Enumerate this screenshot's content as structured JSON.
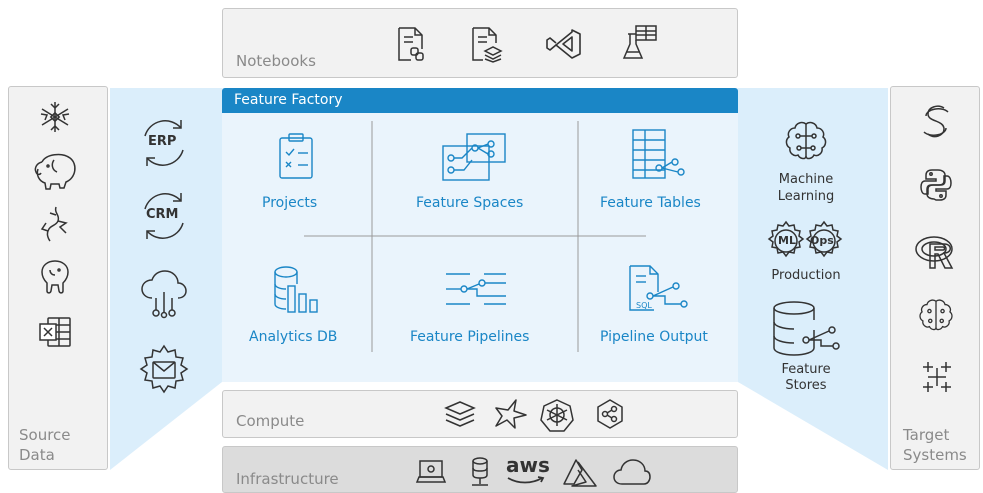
{
  "notebooks": {
    "label": "Notebooks"
  },
  "feature_factory": {
    "title": "Feature Factory",
    "cells": [
      {
        "label": "Projects"
      },
      {
        "label": "Feature Spaces"
      },
      {
        "label": "Feature Tables"
      },
      {
        "label": "Analytics DB"
      },
      {
        "label": "Feature Pipelines"
      },
      {
        "label": "Pipeline Output"
      }
    ]
  },
  "source": {
    "label_line1": "Source",
    "label_line2": "Data"
  },
  "connectors": [
    {
      "text": "ERP"
    },
    {
      "text": "CRM"
    }
  ],
  "targets": {
    "ml_line1": "Machine",
    "ml_line2": "Learning",
    "ops_ml": "ML",
    "ops_ops": "Ops",
    "production": "Production",
    "stores_line1": "Feature",
    "stores_line2": "Stores"
  },
  "target_systems": {
    "label_line1": "Target",
    "label_line2": "Systems"
  },
  "compute": {
    "label": "Compute"
  },
  "infrastructure": {
    "label": "Infrastructure",
    "aws": "aws"
  },
  "colors": {
    "accent": "#1a86c6",
    "panel": "#dbeefb",
    "gray": "#f2f2f2"
  }
}
